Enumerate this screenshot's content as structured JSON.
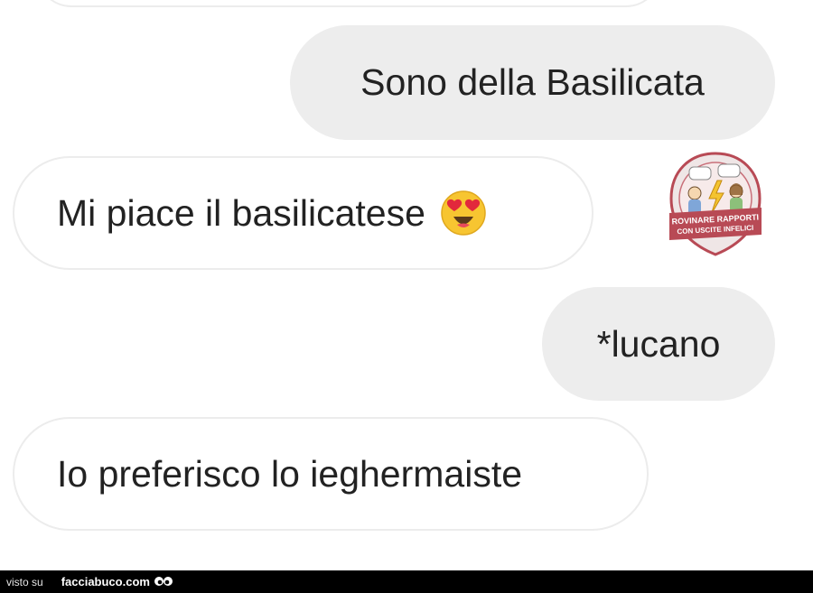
{
  "chat": {
    "messages": [
      {
        "sender": "other",
        "text": ""
      },
      {
        "sender": "me",
        "text": "Sono della Basilicata"
      },
      {
        "sender": "other",
        "text": "Mi piace il basilicatese",
        "emoji": "heart-eyes-emoji"
      },
      {
        "sender": "me",
        "text": "*lucano"
      },
      {
        "sender": "other",
        "text": "Io preferisco lo ieghermaiste"
      }
    ]
  },
  "watermark": {
    "line1": "ROVINARE RAPPORTI",
    "line2": "CON USCITE INFELICI",
    "icon": "comic-characters-badge",
    "color": "#b84a55"
  },
  "footer": {
    "label": "visto su",
    "site": "facciabuco.com",
    "icon": "eyes-icon"
  },
  "colors": {
    "sent_bubble": "#ededed",
    "received_bubble": "#ffffff",
    "text": "#222222",
    "emoji": "#f7c531",
    "footer_bg": "#000000"
  }
}
